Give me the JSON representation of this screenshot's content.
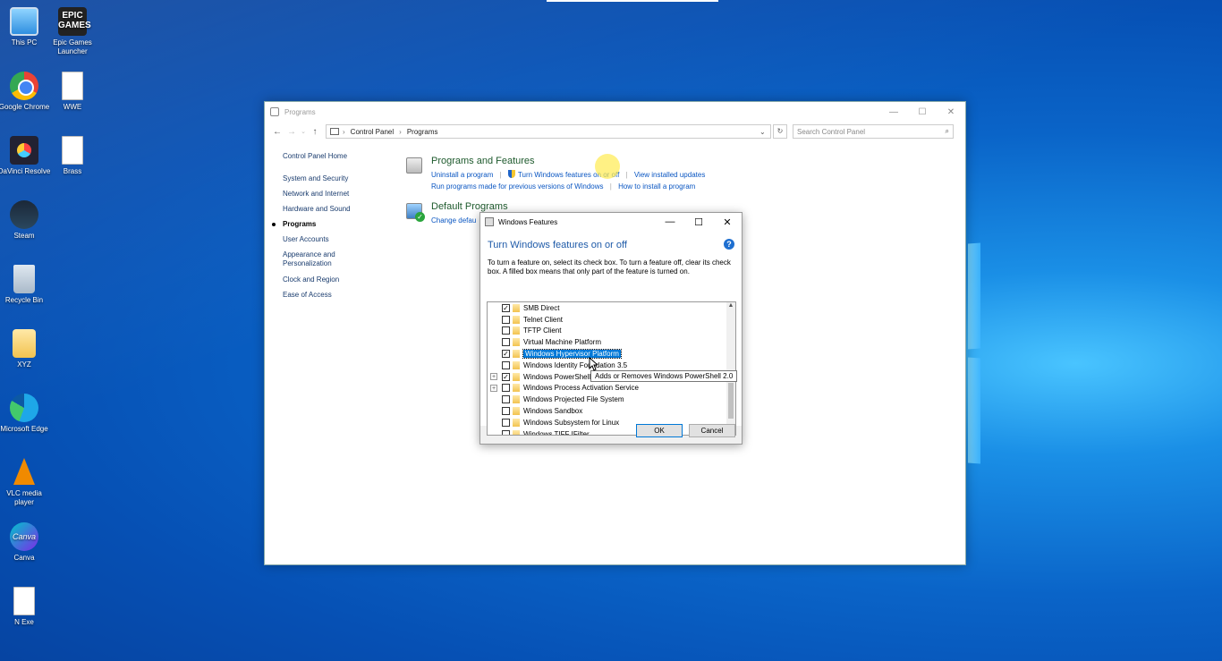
{
  "colors": {
    "desktop_accent": "#0a64c8",
    "link": "#0a56c2",
    "selection": "#0078d7"
  },
  "desktop": {
    "icons": [
      {
        "label": "This PC",
        "icon": "pc-icon"
      },
      {
        "label": "Epic Games Launcher",
        "icon": "epic-icon",
        "glyph": "EPIC GAMES"
      },
      {
        "label": "Google Chrome",
        "icon": "chrome-icon"
      },
      {
        "label": "WWE",
        "icon": "file-icon"
      },
      {
        "label": "DaVinci Resolve",
        "icon": "davinci-icon"
      },
      {
        "label": "Brass",
        "icon": "file-icon"
      },
      {
        "label": "Steam",
        "icon": "steam-icon"
      },
      {
        "label": "Recycle Bin",
        "icon": "recycle-bin-icon"
      },
      {
        "label": "XYZ",
        "icon": "folder-icon"
      },
      {
        "label": "Microsoft Edge",
        "icon": "edge-icon"
      },
      {
        "label": "VLC media player",
        "icon": "vlc-icon"
      },
      {
        "label": "Canva",
        "icon": "canva-icon",
        "glyph": "Canva"
      },
      {
        "label": "N Exe",
        "icon": "file-icon"
      }
    ]
  },
  "control_panel": {
    "title": "Programs",
    "window_controls": [
      "—",
      "☐",
      "✕"
    ],
    "breadcrumb": [
      "Control Panel",
      "Programs"
    ],
    "search_placeholder": "Search Control Panel",
    "left_nav": {
      "home": "Control Panel Home",
      "items": [
        "System and Security",
        "Network and Internet",
        "Hardware and Sound",
        "Programs",
        "User Accounts",
        "Appearance and Personalization",
        "Clock and Region",
        "Ease of Access"
      ],
      "active": "Programs"
    },
    "programs_features": {
      "heading": "Programs and Features",
      "link_uninstall": "Uninstall a program",
      "link_turn_features": "Turn Windows features on or off",
      "link_view_updates": "View installed updates",
      "link_run_previous": "Run programs made for previous versions of Windows",
      "link_how_install": "How to install a program"
    },
    "default_programs": {
      "heading": "Default Programs",
      "link_change": "Change defau"
    }
  },
  "windows_features": {
    "title": "Windows Features",
    "heading": "Turn Windows features on or off",
    "description": "To turn a feature on, select its check box. To turn a feature off, clear its check box. A filled box means that only part of the feature is turned on.",
    "features": [
      {
        "name": "SMB Direct",
        "checked": true,
        "expandable": false,
        "selected": false
      },
      {
        "name": "Telnet Client",
        "checked": false,
        "expandable": false,
        "selected": false
      },
      {
        "name": "TFTP Client",
        "checked": false,
        "expandable": false,
        "selected": false
      },
      {
        "name": "Virtual Machine Platform",
        "checked": false,
        "expandable": false,
        "selected": false
      },
      {
        "name": "Windows Hypervisor Platform",
        "checked": true,
        "expandable": false,
        "selected": true
      },
      {
        "name": "Windows Identity Foundation 3.5",
        "checked": false,
        "expandable": false,
        "selected": false
      },
      {
        "name": "Windows PowerShell 2.0",
        "checked": true,
        "expandable": true,
        "selected": false
      },
      {
        "name": "Windows Process Activation Service",
        "checked": false,
        "expandable": true,
        "selected": false
      },
      {
        "name": "Windows Projected File System",
        "checked": false,
        "expandable": false,
        "selected": false
      },
      {
        "name": "Windows Sandbox",
        "checked": false,
        "expandable": false,
        "selected": false
      },
      {
        "name": "Windows Subsystem for Linux",
        "checked": false,
        "expandable": false,
        "selected": false
      },
      {
        "name": "Windows TIFF IFilter",
        "checked": false,
        "expandable": false,
        "selected": false
      }
    ],
    "tooltip": "Adds or Removes Windows PowerShell 2.0",
    "ok_label": "OK",
    "cancel_label": "Cancel"
  }
}
